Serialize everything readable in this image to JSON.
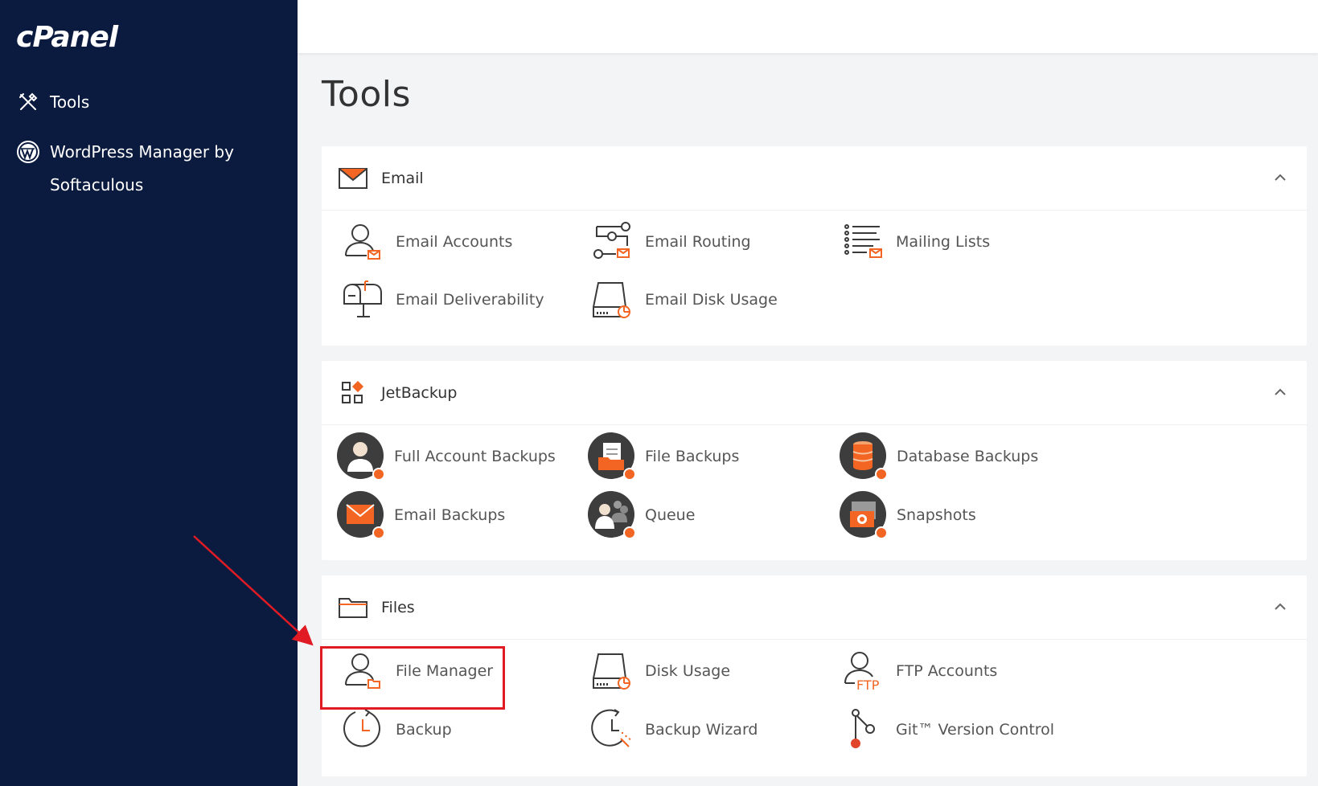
{
  "sidebar": {
    "logo": "cPanel",
    "items": [
      {
        "label": "Tools",
        "icon": "tools-icon"
      },
      {
        "label": "WordPress Manager by Softaculous",
        "icon": "wordpress-icon"
      }
    ]
  },
  "page": {
    "title": "Tools"
  },
  "panels": [
    {
      "title": "Email",
      "icon": "envelope-icon",
      "tools": [
        {
          "label": "Email Accounts",
          "icon": "email-accounts-icon"
        },
        {
          "label": "Email Routing",
          "icon": "email-routing-icon"
        },
        {
          "label": "Mailing Lists",
          "icon": "mailing-lists-icon"
        },
        {
          "label": "Email Deliverability",
          "icon": "mailbox-icon"
        },
        {
          "label": "Email Disk Usage",
          "icon": "disk-usage-icon"
        }
      ]
    },
    {
      "title": "JetBackup",
      "icon": "jetbackup-icon",
      "tools": [
        {
          "label": "Full Account Backups",
          "icon": "full-account-backups-icon"
        },
        {
          "label": "File Backups",
          "icon": "file-backups-icon"
        },
        {
          "label": "Database Backups",
          "icon": "database-backups-icon"
        },
        {
          "label": "Email Backups",
          "icon": "email-backups-icon"
        },
        {
          "label": "Queue",
          "icon": "queue-icon"
        },
        {
          "label": "Snapshots",
          "icon": "snapshots-icon"
        }
      ]
    },
    {
      "title": "Files",
      "icon": "folder-icon",
      "tools": [
        {
          "label": "File Manager",
          "icon": "file-manager-icon"
        },
        {
          "label": "Disk Usage",
          "icon": "disk-usage-icon"
        },
        {
          "label": "FTP Accounts",
          "icon": "ftp-accounts-icon"
        },
        {
          "label": "Backup",
          "icon": "backup-clock-icon"
        },
        {
          "label": "Backup Wizard",
          "icon": "backup-wizard-icon"
        },
        {
          "label": "Git™ Version Control",
          "icon": "git-icon"
        }
      ]
    }
  ],
  "colors": {
    "sidebar_bg": "#0b1b3f",
    "accent_orange": "#f26522",
    "highlight_red": "#e01b24",
    "icon_stroke": "#3a3a3a",
    "dark_circle": "#3d3d3d"
  }
}
